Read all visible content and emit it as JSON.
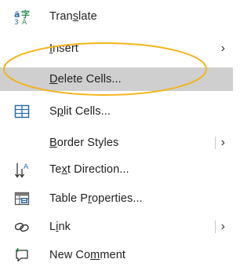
{
  "menu": {
    "items": [
      {
        "pre": "Tran",
        "acc": "s",
        "post": "late",
        "arrow": "",
        "icon": "translate-icon"
      },
      {
        "pre": "",
        "acc": "I",
        "post": "nsert",
        "arrow": "›",
        "icon": ""
      },
      {
        "pre": "",
        "acc": "D",
        "post": "elete Cells...",
        "arrow": "",
        "icon": ""
      },
      {
        "pre": "S",
        "acc": "p",
        "post": "lit Cells...",
        "arrow": "",
        "icon": "split-cells-icon"
      },
      {
        "pre": "",
        "acc": "B",
        "post": "order Styles",
        "arrow": "›",
        "icon": ""
      },
      {
        "pre": "Te",
        "acc": "x",
        "post": "t Direction...",
        "arrow": "",
        "icon": "text-direction-icon"
      },
      {
        "pre": "Table P",
        "acc": "r",
        "post": "operties...",
        "arrow": "",
        "icon": "table-properties-icon"
      },
      {
        "pre": "L",
        "acc": "i",
        "post": "nk",
        "arrow": "›",
        "icon": "link-icon"
      },
      {
        "pre": "New Co",
        "acc": "m",
        "post": "ment",
        "arrow": "",
        "icon": "new-comment-icon"
      }
    ],
    "highlighted_item": "Delete Cells...",
    "annotation_color": "#f2b51b",
    "highlight_color": "#cfcfcf"
  }
}
